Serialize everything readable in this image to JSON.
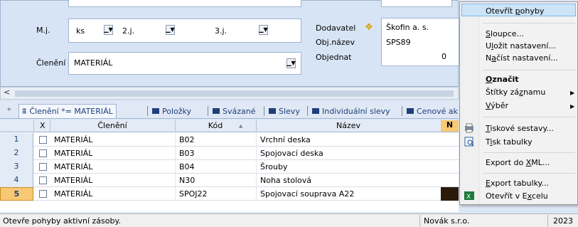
{
  "form": {
    "mj_label": "M.j.",
    "mj_value": "ks",
    "mj2_label": "2.j.",
    "mj3_label": "3.j.",
    "cleneni_label": "Členění",
    "cleneni_value": "MATERIÁL",
    "dodavatel_label": "Dodavatel",
    "dodavatel_value": "Škofin a. s.",
    "objnazev_label": "Obj.název",
    "objnazev_value": "SPS89",
    "objednat_label": "Objednat",
    "objednat_value": "0"
  },
  "tabs": {
    "filter_label": "Členění *= MATERIÁL",
    "items": [
      "Položky",
      "Svázané",
      "Slevy",
      "Individuální slevy",
      "Cenové ak"
    ]
  },
  "grid": {
    "columns": [
      "X",
      "Členění",
      "Kód",
      "Název",
      "N"
    ],
    "rows": [
      {
        "num": "1",
        "cleneni": "MATERIÁL",
        "kod": "B02",
        "nazev": "Vrchní deska"
      },
      {
        "num": "2",
        "cleneni": "MATERIÁL",
        "kod": "B03",
        "nazev": "Spojovací deska"
      },
      {
        "num": "3",
        "cleneni": "MATERIÁL",
        "kod": "B04",
        "nazev": "Šrouby"
      },
      {
        "num": "4",
        "cleneni": "MATERIÁL",
        "kod": "N30",
        "nazev": "Noha stolová"
      },
      {
        "num": "5",
        "cleneni": "MATERIÁL",
        "kod": "SPOJ22",
        "nazev": "Spojovací souprava A22"
      }
    ],
    "selected_row": 5
  },
  "menu": {
    "items": [
      {
        "label": "Otevřít pohyby",
        "highlighted": true
      },
      {
        "label": "Sloupce..."
      },
      {
        "label": "Uložit nastavení..."
      },
      {
        "label": "Načíst nastavení..."
      },
      {
        "label": "Označit",
        "bold": true
      },
      {
        "label": "Štítky záznamu",
        "submenu": true
      },
      {
        "label": "Výběr",
        "submenu": true
      },
      {
        "label": "Tiskové sestavy..."
      },
      {
        "label": "Tisk tabulky"
      },
      {
        "label": "Export do XML..."
      },
      {
        "label": "Export tabulky..."
      },
      {
        "label": "Otevřít v Excelu"
      }
    ]
  },
  "status": {
    "text": "Otevře pohyby aktivní zásoby.",
    "company": "Novák s.r.o.",
    "year": "2023"
  },
  "colors": {
    "selected_row": "#f8c873",
    "menu_highlight": "#cce4f7",
    "form_bg": "#d7e4f5"
  }
}
